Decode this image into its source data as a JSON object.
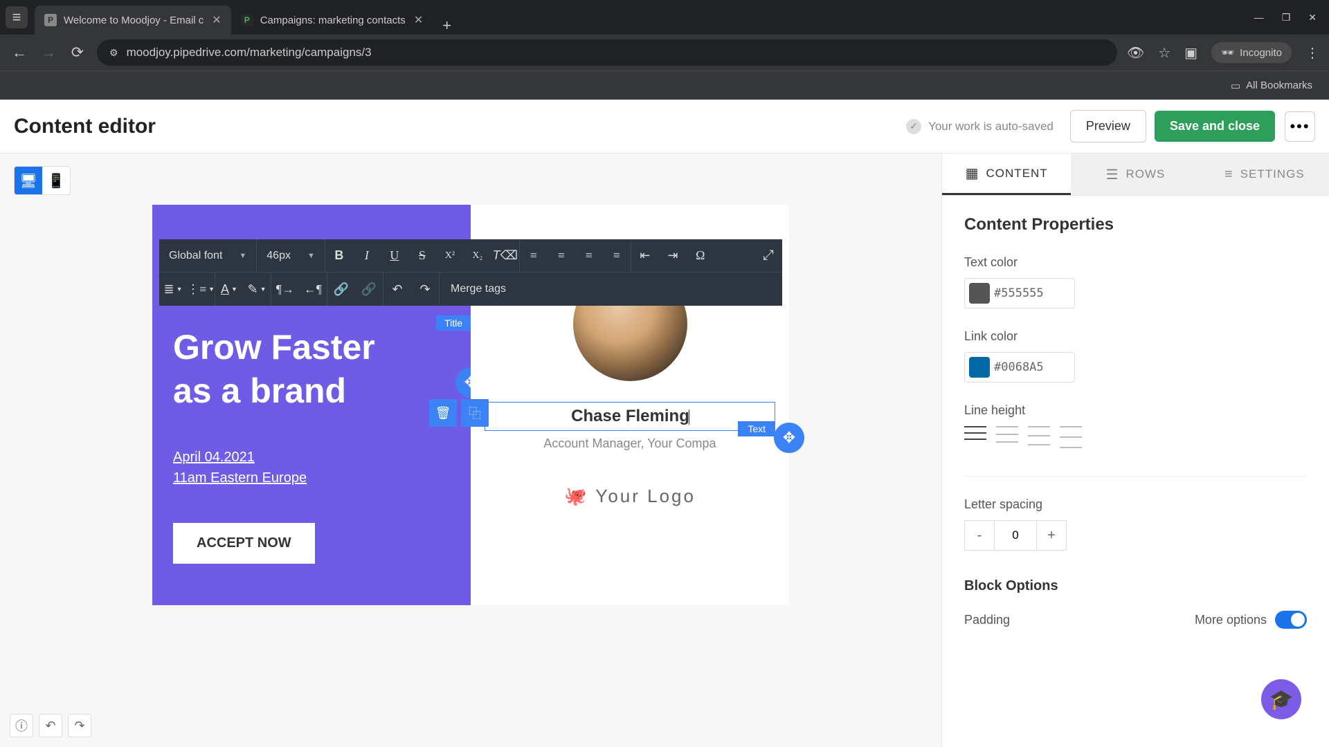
{
  "browser": {
    "tabs": [
      {
        "title": "Welcome to Moodjoy - Email c",
        "favicon": "P"
      },
      {
        "title": "Campaigns: marketing contacts",
        "favicon": "P"
      }
    ],
    "url": "moodjoy.pipedrive.com/marketing/campaigns/3",
    "incognito": "Incognito",
    "all_bookmarks": "All Bookmarks"
  },
  "header": {
    "title": "Content editor",
    "autosave": "Your work is auto-saved",
    "preview": "Preview",
    "save": "Save and close"
  },
  "wysiwyg": {
    "font": "Global font",
    "size": "46px",
    "merge": "Merge tags"
  },
  "canvas": {
    "title_tag": "Title",
    "text_tag": "Text",
    "headline_l1": "Grow Faster",
    "headline_l2": "as a brand",
    "date": "April 04.2021",
    "time": "11am Eastern Europe",
    "cta": "ACCEPT NOW",
    "person_name": "Chase Fleming",
    "person_role": "Account Manager, Your Compa",
    "logo": "Your Logo"
  },
  "panel": {
    "tabs": {
      "content": "CONTENT",
      "rows": "ROWS",
      "settings": "SETTINGS"
    },
    "heading": "Content Properties",
    "text_color_label": "Text color",
    "text_color_value": "#555555",
    "link_color_label": "Link color",
    "link_color_value": "#0068A5",
    "line_height_label": "Line height",
    "letter_spacing_label": "Letter spacing",
    "letter_spacing_value": "0",
    "block_options": "Block Options",
    "padding": "Padding",
    "more_options": "More options"
  }
}
